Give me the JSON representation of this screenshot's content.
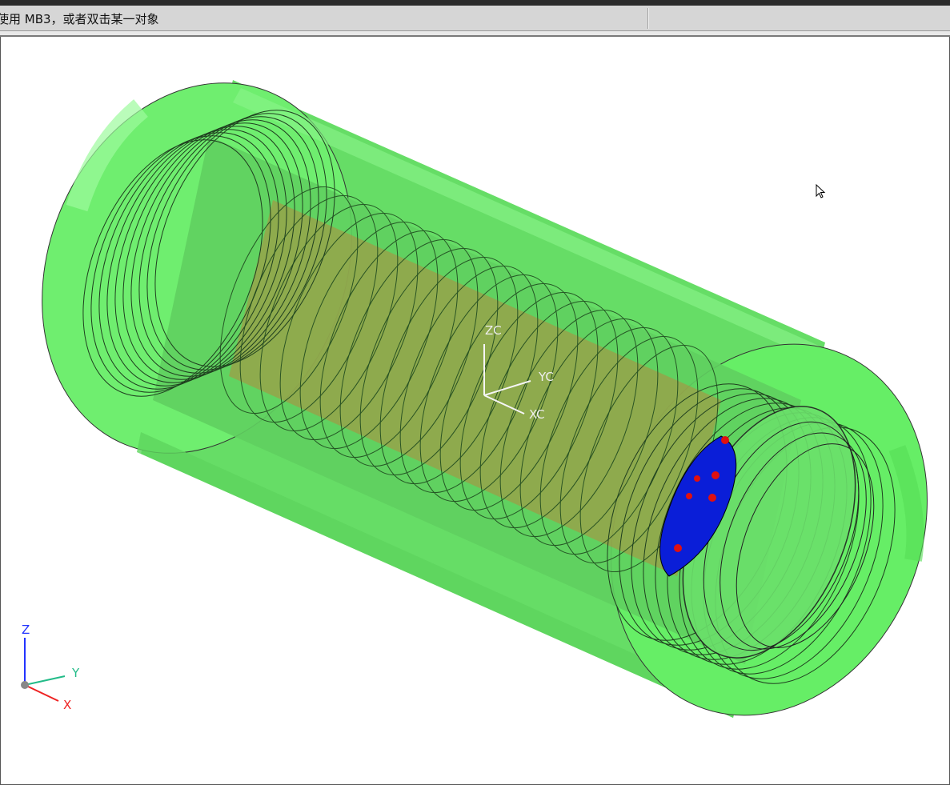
{
  "status_bar": {
    "prompt": "使用 MB3，或者双击某一对象"
  },
  "workcoordinate": {
    "zc": "ZC",
    "yc": "YC",
    "xc": "XC"
  },
  "triad": {
    "z": "Z",
    "y": "Y",
    "x": "X"
  },
  "colors": {
    "outer_sleeve": "#66ee66",
    "thread_lines": "#1a1a1a",
    "inner_core": "#c08a3a",
    "end_plate": "#0a1ed8",
    "bolt_dots": "#e01010",
    "axis_z": "#2233ff",
    "axis_y": "#22bb88",
    "axis_x": "#ee2222"
  },
  "icons": {
    "cursor": "mouse-pointer-icon"
  }
}
